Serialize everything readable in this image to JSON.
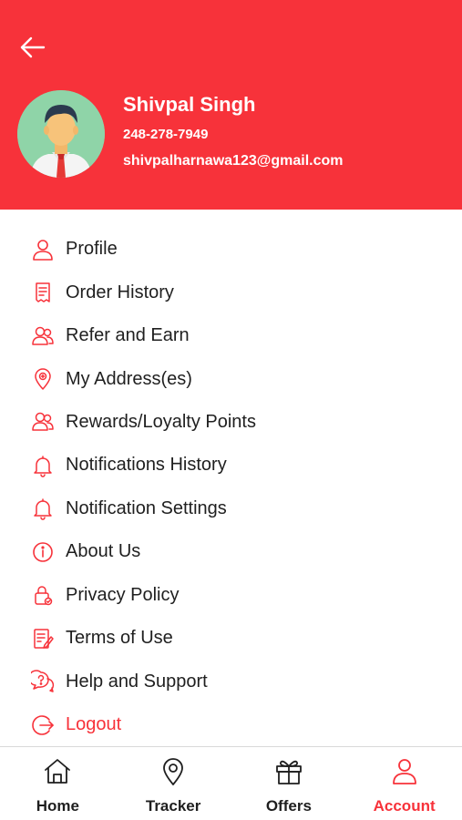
{
  "colors": {
    "accent": "#f7323a",
    "text": "#1f1f1f",
    "avatar_bg": "#8fd4a8"
  },
  "header": {
    "back_icon": "arrow-left-icon",
    "user": {
      "name": "Shivpal Singh",
      "phone": "248-278-7949",
      "email": "shivpalharnawa123@gmail.com"
    }
  },
  "menu": {
    "items": [
      {
        "label": "Profile",
        "icon": "user-icon"
      },
      {
        "label": "Order History",
        "icon": "receipt-icon"
      },
      {
        "label": "Refer and Earn",
        "icon": "users-icon"
      },
      {
        "label": "My Address(es)",
        "icon": "map-pin-icon"
      },
      {
        "label": "Rewards/Loyalty Points",
        "icon": "users-icon"
      },
      {
        "label": "Notifications History",
        "icon": "bell-icon"
      },
      {
        "label": "Notification Settings",
        "icon": "bell-icon"
      },
      {
        "label": "About Us",
        "icon": "info-icon"
      },
      {
        "label": "Privacy Policy",
        "icon": "lock-icon"
      },
      {
        "label": "Terms of Use",
        "icon": "document-icon"
      },
      {
        "label": "Help and Support",
        "icon": "help-chat-icon"
      },
      {
        "label": "Logout",
        "icon": "logout-icon"
      }
    ]
  },
  "bottom_nav": {
    "items": [
      {
        "label": "Home",
        "icon": "home-icon",
        "active": false
      },
      {
        "label": "Tracker",
        "icon": "map-pin-icon",
        "active": false
      },
      {
        "label": "Offers",
        "icon": "gift-icon",
        "active": false
      },
      {
        "label": "Account",
        "icon": "account-icon",
        "active": true
      }
    ]
  }
}
